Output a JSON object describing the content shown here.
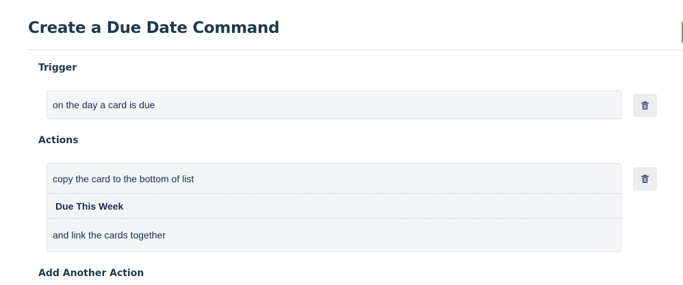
{
  "page": {
    "title": "Create a Due Date Command"
  },
  "trigger": {
    "heading": "Trigger",
    "text": "on the day a card is due",
    "delete_icon": "trash-icon"
  },
  "actions": {
    "heading": "Actions",
    "items": [
      {
        "line1": "copy the card to the bottom of list",
        "list_name": "Due This Week",
        "line2": "and link the cards together",
        "delete_icon": "trash-icon"
      }
    ]
  },
  "add_action": {
    "heading": "Add Another Action"
  },
  "colors": {
    "title": "#1f3a4d",
    "box_bg": "#f4f5f7",
    "button_bg": "#ebecf0",
    "accent": "#5aac44"
  }
}
